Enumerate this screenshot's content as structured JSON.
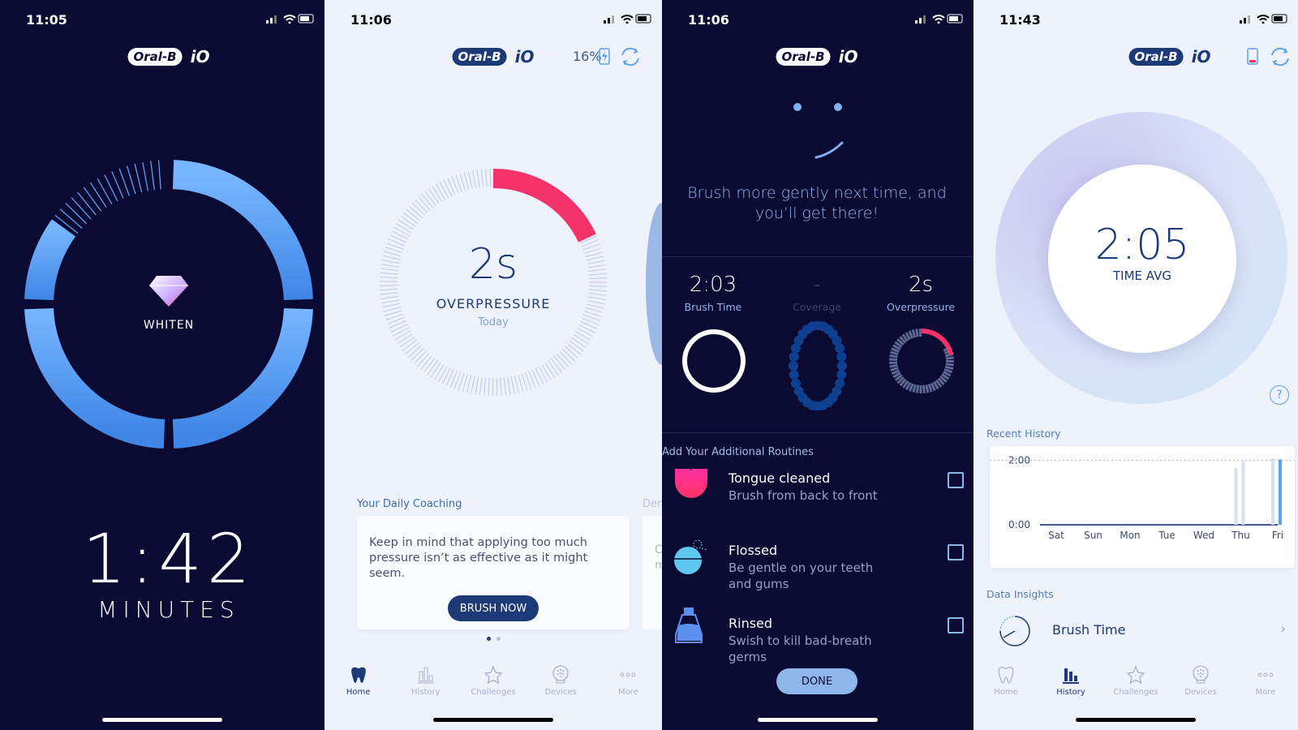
{
  "colors": {
    "navy": "#0b0a33",
    "accent_blue": "#5aa0f0",
    "overpressure_red": "#f4336a",
    "light_bg": "#eef2fa",
    "brand_blue": "#1d3a78"
  },
  "brand": {
    "pill": "Oral-B",
    "suffix": "iO"
  },
  "screen1": {
    "time": "11:05",
    "mode": "WHITEN",
    "mode_icon": "diamond-icon",
    "timer": "1:42",
    "timer_unit": "MINUTES",
    "progress_fraction": 0.85
  },
  "screen2": {
    "time": "11:06",
    "battery": "16%",
    "value": "2s",
    "label": "OVERPRESSURE",
    "sub": "Today",
    "overpressure_fraction": 0.18,
    "coaching_title": "Your Daily Coaching",
    "next_card_title": "Den",
    "coaching_text": "Keep in mind that applying too much pressure isn’t as effective as it might seem.",
    "next_card_text_1": "C",
    "next_card_text_2": "m",
    "brush_now": "BRUSH NOW",
    "pages": 2,
    "current_page": 1
  },
  "screen3": {
    "time": "11:06",
    "message": "Brush more gently next time, and you’ll get there!",
    "stats": [
      {
        "value": "2:03",
        "label": "Brush Time"
      },
      {
        "value": "-",
        "label": "Coverage"
      },
      {
        "value": "2s",
        "label": "Overpressure"
      }
    ],
    "routines_title": "Add Your Additional Routines",
    "routines": [
      {
        "title": "Tongue cleaned",
        "desc": "Brush from back to front",
        "icon": "tongue-icon",
        "checked": false
      },
      {
        "title": "Flossed",
        "desc": "Be gentle on your teeth and gums",
        "icon": "floss-icon",
        "checked": false
      },
      {
        "title": "Rinsed",
        "desc": "Swish to kill bad-breath germs",
        "icon": "mouthwash-icon",
        "checked": false
      }
    ],
    "done": "DONE"
  },
  "screen4": {
    "time": "11:43",
    "avg": "2:05",
    "avg_label": "TIME AVG",
    "help": "?",
    "recent_title": "Recent History",
    "insights_title": "Data Insights",
    "insight_item": "Brush Time"
  },
  "nav": [
    {
      "label": "Home",
      "icon": "tooth-icon"
    },
    {
      "label": "History",
      "icon": "bar-chart-icon"
    },
    {
      "label": "Challenges",
      "icon": "star-icon"
    },
    {
      "label": "Devices",
      "icon": "brush-head-icon"
    },
    {
      "label": "More",
      "icon": "more-icon"
    }
  ],
  "chart_data": {
    "type": "bar",
    "categories": [
      "Sat",
      "Sun",
      "Mon",
      "Tue",
      "Wed",
      "Thu",
      "Fri"
    ],
    "ytick_labels": [
      "0:00",
      "2:00"
    ],
    "ylim_minutes": [
      0,
      2.3
    ],
    "reference_line_minutes": 2,
    "sessions_minutes": {
      "Sat": [],
      "Sun": [],
      "Mon": [],
      "Tue": [],
      "Wed": [],
      "Thu": [
        1.75,
        2.0
      ],
      "Fri": [
        2.05,
        2.03
      ]
    },
    "highlighted": "Fri last session"
  }
}
